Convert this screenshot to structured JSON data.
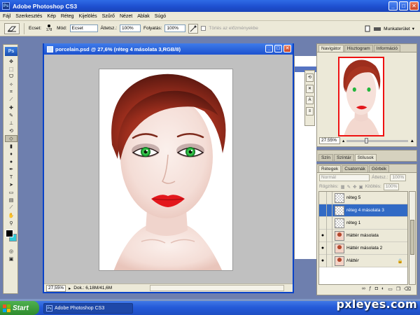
{
  "window": {
    "title": "Adobe Photoshop CS3",
    "app_icon": "Ps",
    "min_glyph": "_",
    "max_glyph": "□",
    "close_glyph": "✕"
  },
  "menu": [
    "Fájl",
    "Szerkesztés",
    "Kép",
    "Réteg",
    "Kijelölés",
    "Szűrő",
    "Nézet",
    "Ablak",
    "Súgó"
  ],
  "options_bar": {
    "brush_label": "Ecset:",
    "brush_size": "178",
    "mode_label": "Mód:",
    "mode_value": "Ecset",
    "opacity_label": "Áttetsz.:",
    "opacity_value": "100%",
    "flow_label": "Folyatás:",
    "flow_value": "100%",
    "history_label": "Törlés az előzményekbe",
    "workspace_label": "Munkaterület"
  },
  "document": {
    "title": "porcelain.psd @ 27,6% (réteg 4 másolata 3,RGB/8)",
    "zoom": "27,55%",
    "doc_info": "Dok.: 6,18M/41,6M"
  },
  "navigator": {
    "tabs": [
      "Navigátor",
      "Hisztogram",
      "Információ"
    ],
    "zoom": "27.55%"
  },
  "color_panel": {
    "tabs": [
      "Szín",
      "Színtár",
      "Stílusok"
    ]
  },
  "layers_panel": {
    "tabs": [
      "Rétegek",
      "Csatornák",
      "Görbék"
    ],
    "blend_mode": "Normál",
    "opacity_label": "Áttetsz.:",
    "opacity_value": "100%",
    "lock_label": "Rögzítés:",
    "fill_label": "Kitöltés:",
    "fill_value": "100%",
    "eye_glyph": "●",
    "layers": [
      {
        "name": "réteg 5",
        "visible": false,
        "selected": false,
        "thumb": "transparent"
      },
      {
        "name": "réteg 4 másolata 3",
        "visible": false,
        "selected": true,
        "thumb": "transparent"
      },
      {
        "name": "réteg 1",
        "visible": false,
        "selected": false,
        "thumb": "transparent"
      },
      {
        "name": "Háttér másolata",
        "visible": true,
        "selected": false,
        "thumb": "face"
      },
      {
        "name": "Háttér másolata 2",
        "visible": true,
        "selected": false,
        "thumb": "face"
      },
      {
        "name": "Háttér",
        "visible": true,
        "selected": false,
        "thumb": "face",
        "italic": true,
        "locked": true
      }
    ]
  },
  "taskbar": {
    "start_label": "Start",
    "task_label": "Adobe Photoshop CS3"
  },
  "watermark": "pxleyes.com",
  "colors": {
    "accent": "#0a43c8",
    "lip": "#e3171c",
    "hair": "#9d2e1d",
    "eye": "#23b63c",
    "bg_swatch": "#31c8d6"
  }
}
